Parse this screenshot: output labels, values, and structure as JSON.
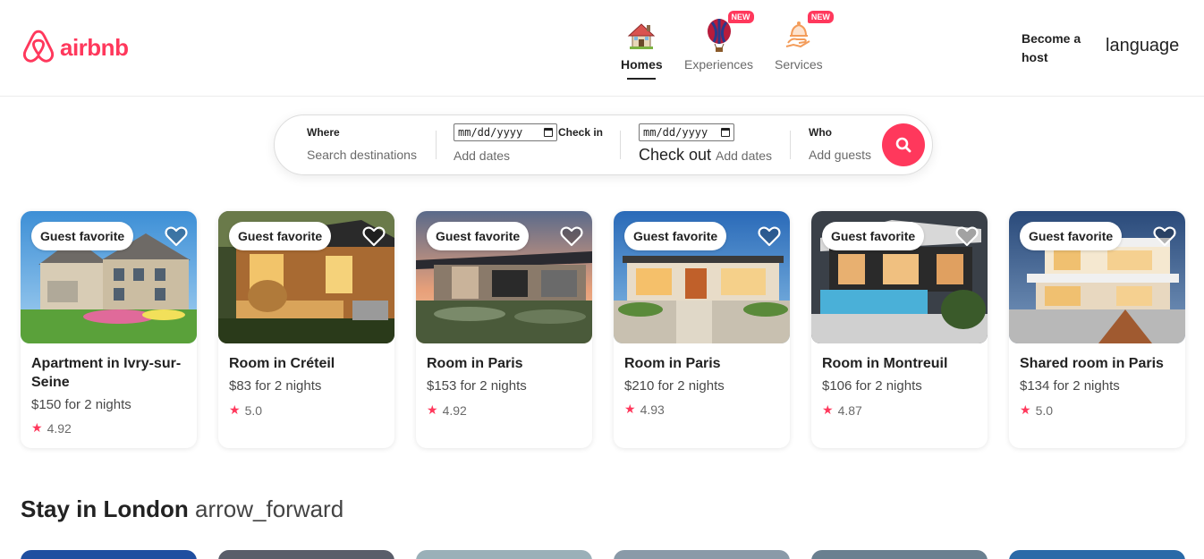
{
  "header": {
    "logo_text": "airbnb",
    "categories": [
      {
        "label": "Homes",
        "icon": "house-icon",
        "active": true,
        "badge": ""
      },
      {
        "label": "Experiences",
        "icon": "hot-air-balloon-icon",
        "active": false,
        "badge": "NEW"
      },
      {
        "label": "Services",
        "icon": "bell-service-icon",
        "active": false,
        "badge": "NEW"
      }
    ],
    "become_host": "Become a host",
    "language": "language"
  },
  "search": {
    "where_label": "Where",
    "where_placeholder": "Search destinations",
    "checkin_date_value": "mm/dd/yyyy",
    "checkin_label": "Check in",
    "checkin_placeholder": "Add dates",
    "checkout_date_value": "mm/dd/yyyy",
    "checkout_label": "Check out",
    "checkout_placeholder": "Add dates",
    "who_label": "Who",
    "who_placeholder": "Add guests",
    "button_icon": "search-icon"
  },
  "listings": [
    {
      "badge": "Guest favorite",
      "title": "Apartment in Ivry-sur-Seine",
      "price": "$150 for 2 nights",
      "rating": "4.92"
    },
    {
      "badge": "Guest favorite",
      "title": "Room in Créteil",
      "price": "$83 for 2 nights",
      "rating": "5.0"
    },
    {
      "badge": "Guest favorite",
      "title": "Room in Paris",
      "price": "$153 for 2 nights",
      "rating": "4.92"
    },
    {
      "badge": "Guest favorite",
      "title": "Room in Paris",
      "price": "$210 for 2 nights",
      "rating": "4.93"
    },
    {
      "badge": "Guest favorite",
      "title": "Room in Montreuil",
      "price": "$106 for 2 nights",
      "rating": "4.87"
    },
    {
      "badge": "Guest favorite",
      "title": "Shared room in Paris",
      "price": "$134 for 2 nights",
      "rating": "5.0"
    }
  ],
  "section": {
    "title": "Stay in London",
    "arrow_text": "arrow_forward"
  },
  "colors": {
    "brand": "#ff385c",
    "text": "#222222",
    "muted": "#6a6a6a"
  }
}
